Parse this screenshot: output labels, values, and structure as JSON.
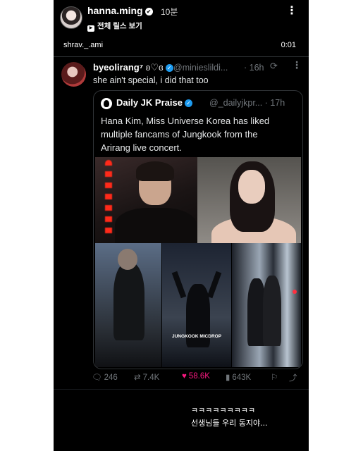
{
  "story": {
    "username": "hanna.ming",
    "time_ago": "10분",
    "reels_label": "전체 릴스 보기",
    "music_user": "shrav._.ami",
    "timestamp": "0:01"
  },
  "tweet": {
    "display_name": "byeolirang⁷",
    "handle": "@minieslildi...",
    "age": "· 16h",
    "text": "she ain't special, i did that too"
  },
  "quote": {
    "display_name": "Daily JK Praise",
    "handle": "@_dailyjkpr... · 17h",
    "lines": [
      "Hana Kim, Miss Universe Korea has liked",
      "multiple fancams of Jungkook from the",
      "Arirang live concert."
    ],
    "image_caption": "JUNGKOOK MICDROP"
  },
  "actions": {
    "replies": "246",
    "reposts": "7.4K",
    "likes": "58.6K",
    "views": "643K"
  },
  "caption": {
    "line1": "ㅋㅋㅋㅋㅋㅋㅋㅋㅋ",
    "line2": "선생님들 우리 동지야..."
  },
  "colors": {
    "background": "#000000",
    "like": "#f91880",
    "verified_blue": "#1d9bf0",
    "muted": "#71767b"
  }
}
